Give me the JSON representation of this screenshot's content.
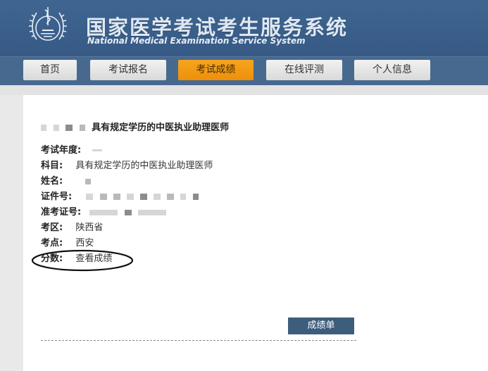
{
  "header": {
    "title_zh": "国家医学考试考生服务系统",
    "title_en": "National Medical Examination Service System"
  },
  "nav": {
    "items": [
      {
        "label": "首页",
        "active": false
      },
      {
        "label": "考试报名",
        "active": false
      },
      {
        "label": "考试成绩",
        "active": true
      },
      {
        "label": "在线评测",
        "active": false
      },
      {
        "label": "个人信息",
        "active": false
      }
    ]
  },
  "panel": {
    "heading": "具有规定学历的中医执业助理医师",
    "fields": [
      {
        "label": "考试年度:",
        "value": ""
      },
      {
        "label": "科目:",
        "value": "具有规定学历的中医执业助理医师"
      },
      {
        "label": "姓名:",
        "value": ""
      },
      {
        "label": "证件号:",
        "value": ""
      },
      {
        "label": "准考证号:",
        "value": ""
      },
      {
        "label": "考区:",
        "value": "陕西省"
      },
      {
        "label": "考点:",
        "value": "西安"
      }
    ],
    "score": {
      "label": "分数:",
      "link": "查看成绩"
    },
    "report_button": "成绩单"
  },
  "colors": {
    "header_bg": "#3a5f8b",
    "nav_bg": "#48698f",
    "active_tab": "#f39a14",
    "button_bg": "#3d5d7d",
    "link": "#2f5f8f"
  }
}
